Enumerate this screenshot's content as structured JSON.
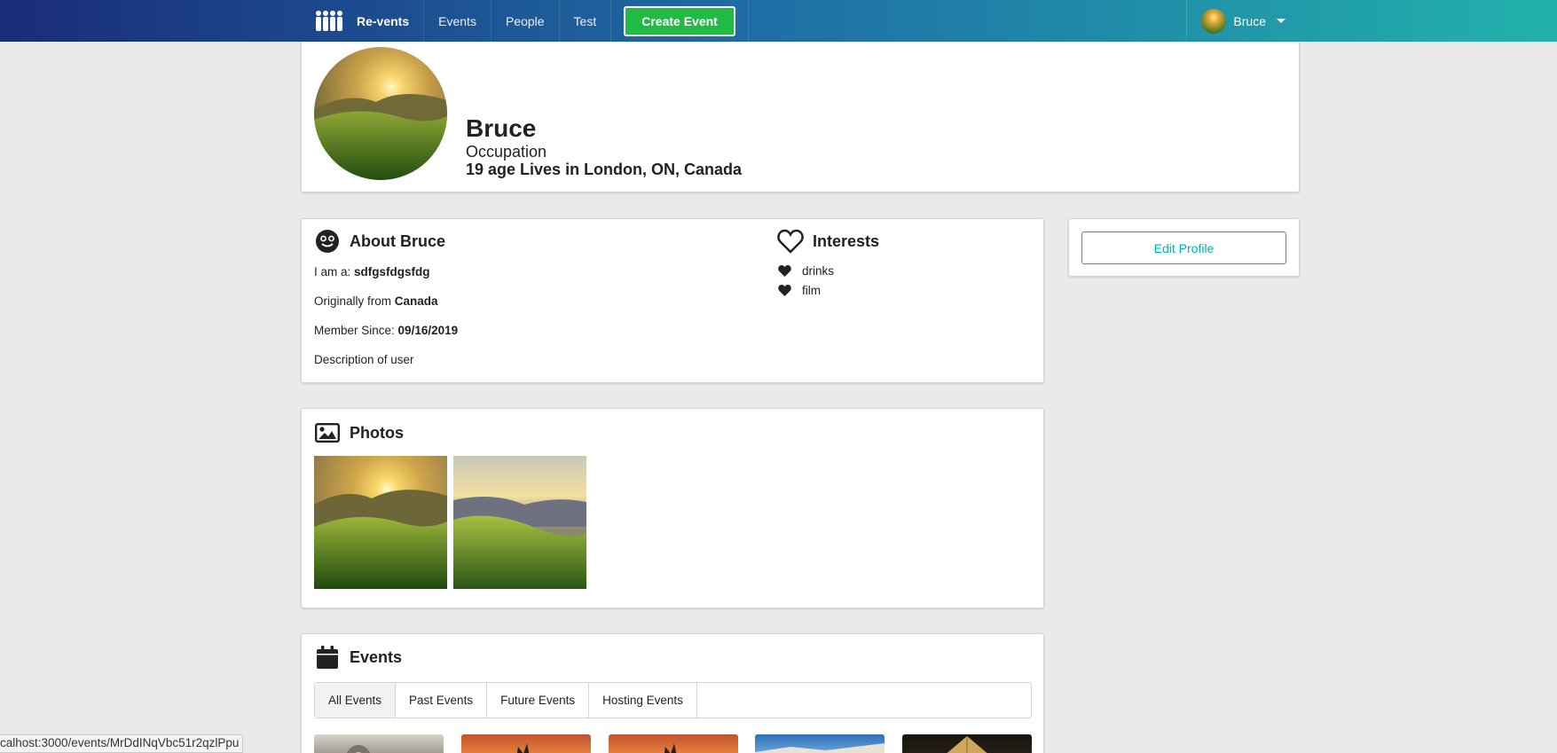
{
  "navbar": {
    "brand": "Re-vents",
    "logo_icon": "people-group-icon",
    "links": [
      "Events",
      "People",
      "Test"
    ],
    "create_button": "Create Event",
    "user_name": "Bruce"
  },
  "profile": {
    "name": "Bruce",
    "occupation": "Occupation",
    "location_line": "19 age Lives in London, ON, Canada"
  },
  "about": {
    "heading": "About Bruce",
    "iam_label": "I am a: ",
    "iam_value": "sdfgsfdgsfdg",
    "origin_label": "Originally from ",
    "origin_value": "Canada",
    "member_label": "Member Since: ",
    "member_value": "09/16/2019",
    "description": "Description of user"
  },
  "interests": {
    "heading": "Interests",
    "items": [
      "drinks",
      "film"
    ]
  },
  "sidebar": {
    "edit_button": "Edit Profile"
  },
  "photos": {
    "heading": "Photos",
    "count": 2
  },
  "events": {
    "heading": "Events",
    "tabs": [
      "All Events",
      "Past Events",
      "Future Events",
      "Hosting Events"
    ],
    "active_tab": "All Events"
  },
  "statusbar": {
    "url": "calhost:3000/events/MrDdINqVbc51r2qzlPpu"
  },
  "colors": {
    "nav_start": "#1a2c7a",
    "nav_end": "#22b2ab",
    "create_green": "#21ba45",
    "teal": "#00b5ad"
  }
}
